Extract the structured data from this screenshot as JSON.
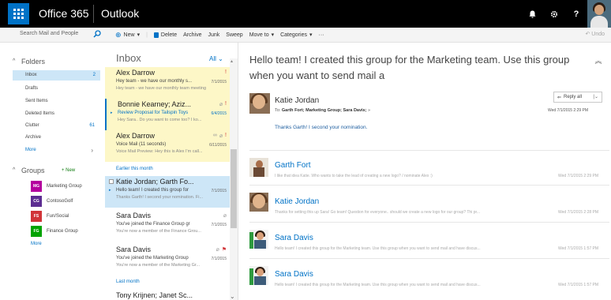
{
  "suite": {
    "brand": "Office 365",
    "app": "Outlook",
    "bell": "🔔",
    "gear": "⚙",
    "help": "?"
  },
  "commands": {
    "search_placeholder": "Search Mail and People",
    "new": "New",
    "delete": "Delete",
    "archive": "Archive",
    "junk": "Junk",
    "sweep": "Sweep",
    "move_to": "Move to",
    "categories": "Categories",
    "more": "···",
    "undo": "Undo"
  },
  "folders": {
    "heading": "Folders",
    "items": [
      {
        "label": "Inbox",
        "count": "2",
        "selected": true
      },
      {
        "label": "Drafts",
        "count": ""
      },
      {
        "label": "Sent Items",
        "count": ""
      },
      {
        "label": "Deleted Items",
        "count": ""
      },
      {
        "label": "Clutter",
        "count": "61"
      },
      {
        "label": "Archive",
        "count": ""
      }
    ],
    "more": "More"
  },
  "groups": {
    "heading": "Groups",
    "new_label": "+ New",
    "items": [
      {
        "label": "Marketing Group",
        "initials": "MG",
        "color": "#b4009e"
      },
      {
        "label": "ContosoGolf",
        "initials": "CG",
        "color": "#5c2d91"
      },
      {
        "label": "Fun/Social",
        "initials": "FS",
        "color": "#d13438"
      },
      {
        "label": "Finance Group",
        "initials": "FG",
        "color": "#00a300"
      }
    ],
    "more": "More"
  },
  "list": {
    "title": "Inbox",
    "filter": "All",
    "messages": [
      {
        "sender": "Alex Darrow",
        "subject": "Hey team - we have our monthly s...",
        "preview": "Hey team - we have our monthly team meeting",
        "date": "7/1/2015"
      },
      {
        "sender": "Bonnie Kearney; Aziz...",
        "subject": "Review Proposal for Tailspin Toys",
        "preview": "Hey Sara.. Do you want to come too? I ko...",
        "date": "6/4/2015"
      },
      {
        "sender": "Alex Darrow",
        "subject": "Voice Mail (11 seconds)",
        "preview": "Voice Mail Preview: Hey this is Alex I'm call...",
        "date": "6/11/2015"
      },
      {
        "sender": "Katie Jordan; Garth Fo...",
        "subject": "Hello team! I created this group for",
        "preview": "Thanks Garth! I second your nomination. Fi...",
        "date": "7/1/2015"
      },
      {
        "sender": "Sara Davis",
        "subject": "You've joined the Finance Group gr",
        "preview": "You're now a member of the Finance Grou...",
        "date": "7/1/2015"
      },
      {
        "sender": "Sara Davis",
        "subject": "You've joined the Marketing Group",
        "preview": "You're now a member of the Marketing Gr...",
        "date": "7/1/2015"
      },
      {
        "sender": "Tony Krijnen; Janet Sc...",
        "subject": "",
        "preview": "",
        "date": ""
      }
    ],
    "sep_earlier": "Earlier this month",
    "sep_last": "Last month"
  },
  "reading": {
    "title": "Hello team! I created this group for the Marketing team. Use this group when you want to send mail a",
    "first": {
      "sender": "Katie Jordan",
      "to_label": "To:",
      "to_list": "Garth Fort; Marketing Group; Sara Davis;",
      "body": "Thanks Garth! I second your nomination.",
      "reply": "Reply all",
      "date": "Wed 7/1/2015 2:29 PM"
    },
    "replies": [
      {
        "sender": "Garth Fort",
        "preview": "I like that idea Katie. Who wants to take the lead of creating a new logo? / nominate Alex :)",
        "date": "Wed 7/1/2015 2:29 PM"
      },
      {
        "sender": "Katie Jordan",
        "preview": "Thanks for setting this up Sara! Go team! Question for everyone.. should we create a new logo for our group? Thi pr...",
        "date": "Wed 7/1/2015 2:28 PM"
      },
      {
        "sender": "Sara Davis",
        "preview": "Hello team! I created this group for the Marketing team. Use this group when you want to send mail and have discus...",
        "date": "Wed 7/1/2015 1:57 PM"
      },
      {
        "sender": "Sara Davis",
        "preview": "Hello team! I created this group for the Marketing team. Use this group when you want to send mail and have discus...",
        "date": "Wed 7/1/2015 1:57 PM"
      }
    ]
  }
}
